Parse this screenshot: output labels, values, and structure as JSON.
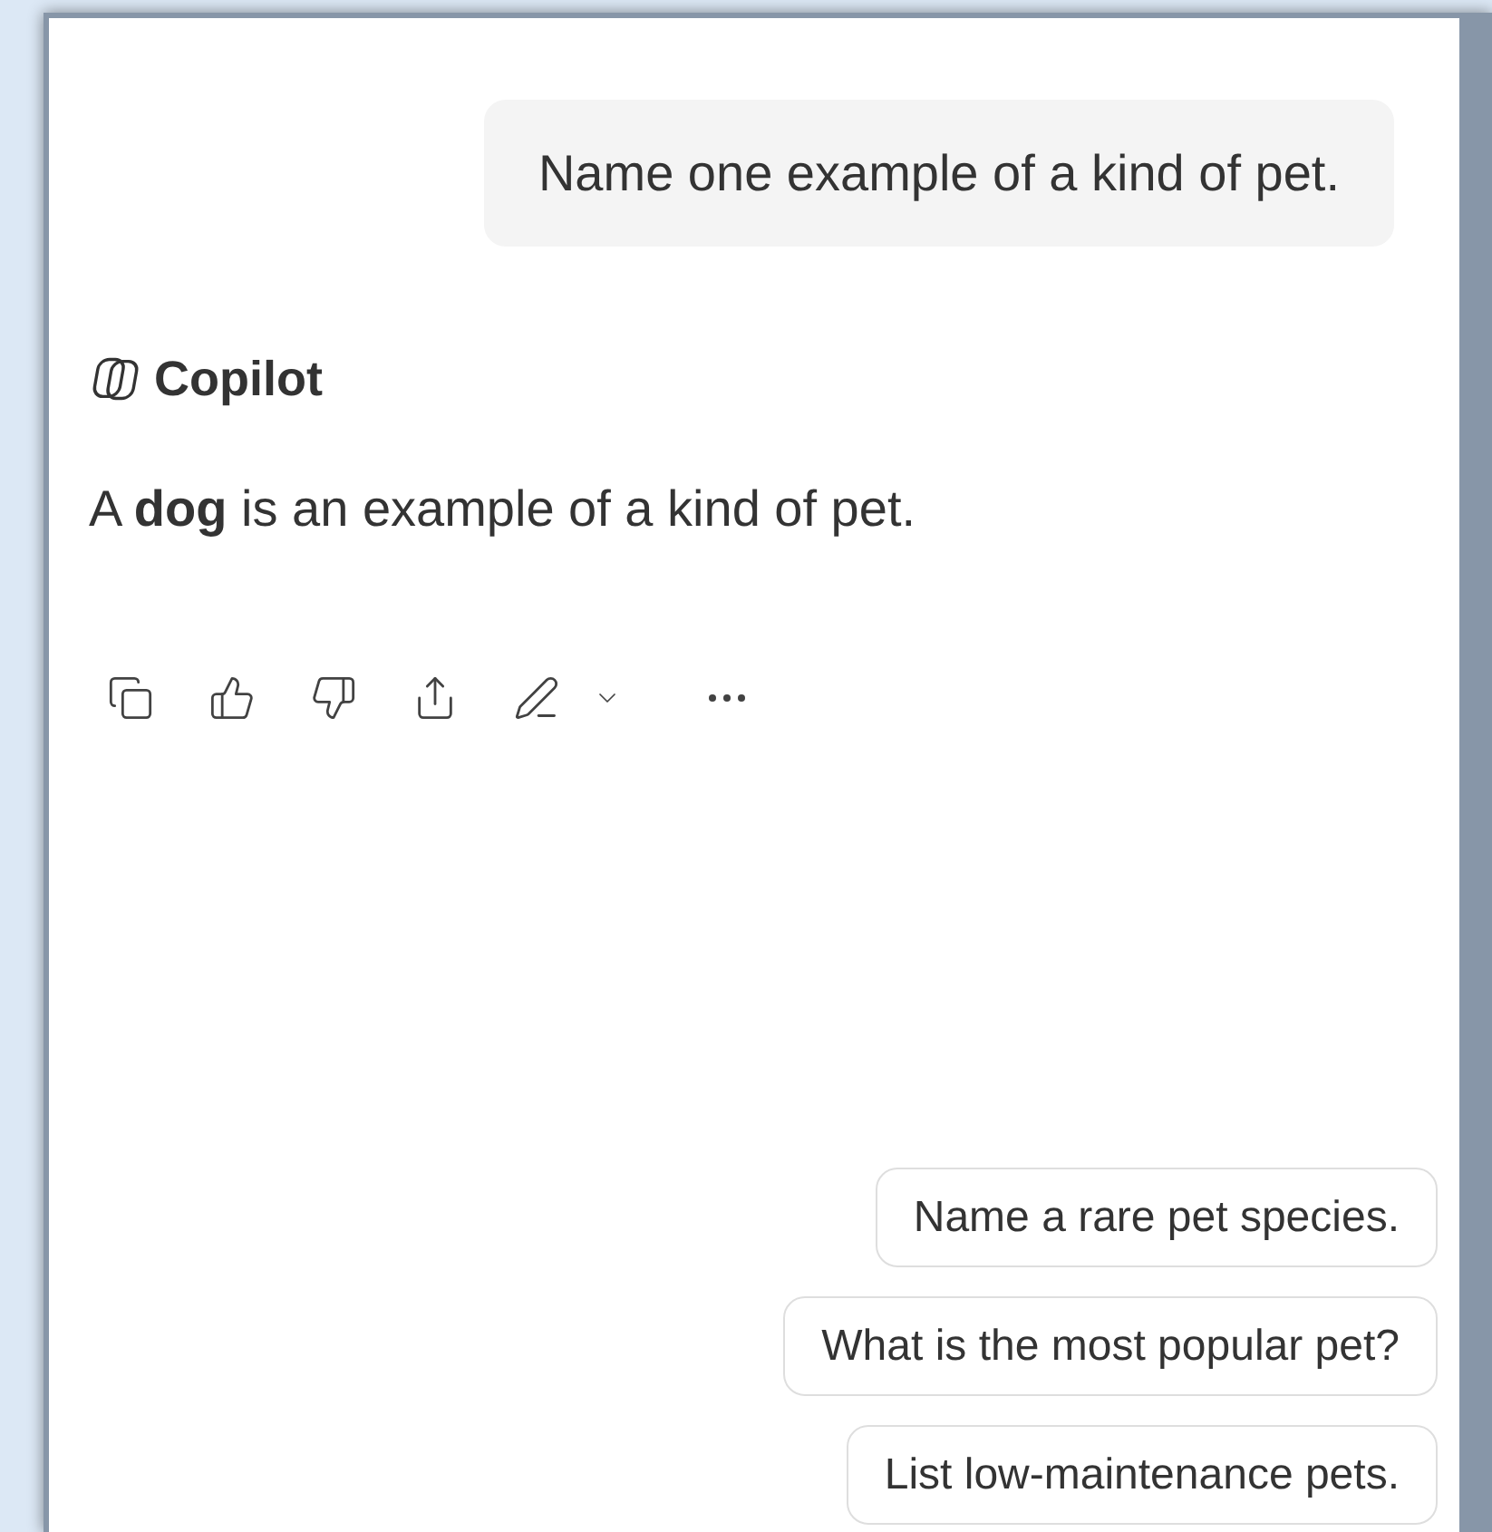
{
  "user_message": "Name one example of a kind of pet.",
  "assistant": {
    "name": "Copilot",
    "response": "A **dog** is an example of a kind of pet."
  },
  "actions": [
    {
      "kind": "copy"
    },
    {
      "kind": "like"
    },
    {
      "kind": "dislike"
    },
    {
      "kind": "share"
    },
    {
      "kind": "edit"
    },
    {
      "kind": "more"
    }
  ],
  "suggestions": [
    "Name a rare pet species.",
    "What is the most popular pet?",
    "List low-maintenance pets."
  ]
}
